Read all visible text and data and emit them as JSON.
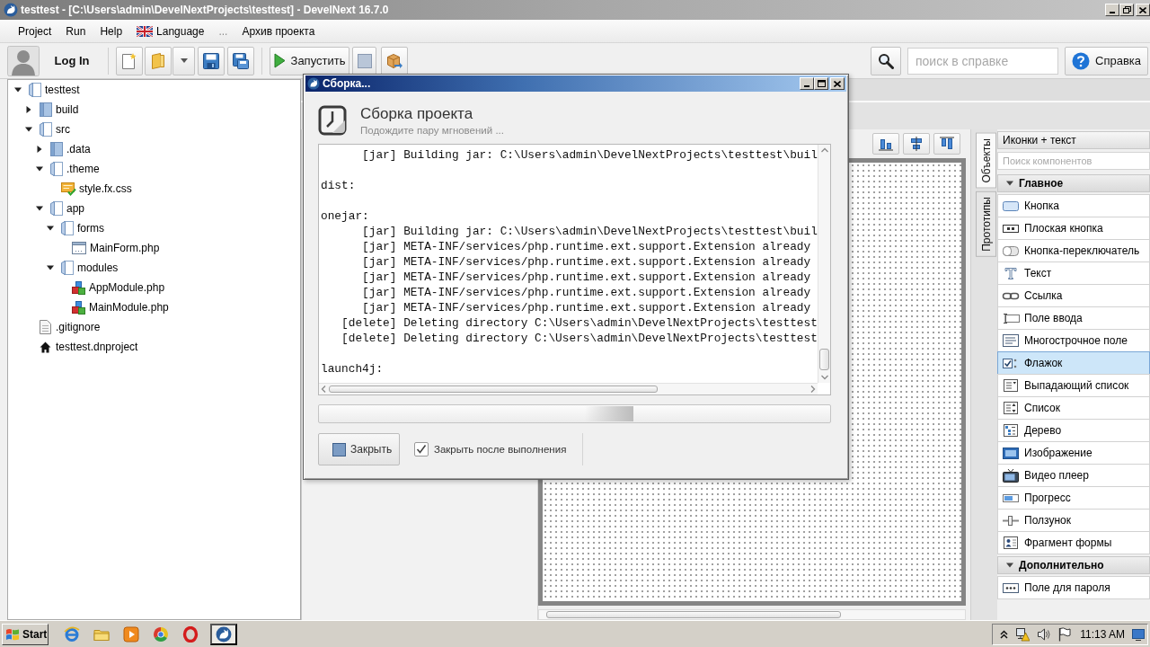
{
  "window": {
    "title": "testtest - [C:\\Users\\admin\\DevelNextProjects\\testtest] - DevelNext 16.7.0",
    "active": false
  },
  "menu": [
    {
      "label": "Project",
      "kind": "plain",
      "disabled": false
    },
    {
      "label": "Run",
      "kind": "plain",
      "disabled": false
    },
    {
      "label": "Help",
      "kind": "plain",
      "disabled": false
    },
    {
      "label": "Language",
      "kind": "flag",
      "disabled": false
    },
    {
      "label": "...",
      "kind": "plain",
      "disabled": true
    },
    {
      "label": "Архив проекта",
      "kind": "plain",
      "disabled": false
    }
  ],
  "toolbar": {
    "login": "Log In",
    "run": "Запустить",
    "help_search": {
      "placeholder": "поиск в справке"
    },
    "help": "Справка"
  },
  "project_tree": [
    {
      "label": "testtest",
      "kind": "folder",
      "expanded": true,
      "selected": false,
      "children": [
        {
          "label": "build",
          "kind": "folder",
          "expanded": false,
          "selected": false
        },
        {
          "label": "src",
          "kind": "folder",
          "expanded": true,
          "selected": false,
          "children": [
            {
              "label": ".data",
              "kind": "folder",
              "expanded": false,
              "selected": false
            },
            {
              "label": ".theme",
              "kind": "folder",
              "expanded": true,
              "selected": false,
              "children": [
                {
                  "label": "style.fx.css",
                  "kind": "stylesheet",
                  "selected": false
                }
              ]
            },
            {
              "label": "app",
              "kind": "folder",
              "expanded": true,
              "selected": false,
              "children": [
                {
                  "label": "forms",
                  "kind": "folder",
                  "expanded": true,
                  "selected": false,
                  "children": [
                    {
                      "label": "MainForm.php",
                      "kind": "form",
                      "selected": false
                    }
                  ]
                },
                {
                  "label": "modules",
                  "kind": "folder",
                  "expanded": true,
                  "selected": false,
                  "children": [
                    {
                      "label": "AppModule.php",
                      "kind": "module",
                      "selected": false
                    },
                    {
                      "label": "MainModule.php",
                      "kind": "module",
                      "selected": false
                    }
                  ]
                }
              ]
            }
          ]
        },
        {
          "label": ".gitignore",
          "kind": "file",
          "selected": false
        },
        {
          "label": "testtest.dnproject",
          "kind": "project",
          "selected": false
        }
      ]
    }
  ],
  "side_tabs": [
    {
      "label": "Объекты",
      "selected": true
    },
    {
      "label": "Прототипы",
      "selected": false
    }
  ],
  "components": {
    "view": "Иконки + текст",
    "search": {
      "placeholder": "Поиск компонентов"
    },
    "groups": [
      {
        "title": "Главное",
        "expanded": true,
        "items": [
          {
            "label": "Кнопка",
            "kind": "button",
            "selected": false
          },
          {
            "label": "Плоская кнопка",
            "kind": "flat_button",
            "selected": false
          },
          {
            "label": "Кнопка-переключатель",
            "kind": "toggle",
            "selected": false
          },
          {
            "label": "Текст",
            "kind": "label",
            "selected": false
          },
          {
            "label": "Ссылка",
            "kind": "link",
            "selected": false
          },
          {
            "label": "Поле ввода",
            "kind": "input",
            "selected": false
          },
          {
            "label": "Многострочное поле",
            "kind": "textarea",
            "selected": false
          },
          {
            "label": "Флажок",
            "kind": "checkbox",
            "selected": true
          },
          {
            "label": "Выпадающий список",
            "kind": "combobox",
            "selected": false
          },
          {
            "label": "Список",
            "kind": "list",
            "selected": false
          },
          {
            "label": "Дерево",
            "kind": "tree",
            "selected": false
          },
          {
            "label": "Изображение",
            "kind": "image",
            "selected": false
          },
          {
            "label": "Видео плеер",
            "kind": "video",
            "selected": false
          },
          {
            "label": "Прогресс",
            "kind": "progress",
            "selected": false
          },
          {
            "label": "Ползунок",
            "kind": "slider",
            "selected": false
          },
          {
            "label": "Фрагмент формы",
            "kind": "fragment",
            "selected": false
          }
        ]
      },
      {
        "title": "Дополнительно",
        "expanded": true,
        "items": [
          {
            "label": "Поле для пароля",
            "kind": "password",
            "selected": false
          }
        ]
      }
    ]
  },
  "build_dialog": {
    "title": "Сборка...",
    "active": true,
    "heading": "Сборка проекта",
    "subtitle": "Подождите пару мгновений ...",
    "log": [
      {
        "kind": "task",
        "text": "[jar] Building jar: C:\\Users\\admin\\DevelNextProjects\\testtest\\buil"
      },
      {
        "kind": "target",
        "text": "dist:"
      },
      {
        "kind": "target",
        "text": "onejar:"
      },
      {
        "kind": "task",
        "text": "[jar] Building jar: C:\\Users\\admin\\DevelNextProjects\\testtest\\buil"
      },
      {
        "kind": "task",
        "text": "[jar] META-INF/services/php.runtime.ext.support.Extension already"
      },
      {
        "kind": "task",
        "text": "[jar] META-INF/services/php.runtime.ext.support.Extension already"
      },
      {
        "kind": "task",
        "text": "[jar] META-INF/services/php.runtime.ext.support.Extension already"
      },
      {
        "kind": "task",
        "text": "[jar] META-INF/services/php.runtime.ext.support.Extension already"
      },
      {
        "kind": "task",
        "text": "[jar] META-INF/services/php.runtime.ext.support.Extension already"
      },
      {
        "kind": "task",
        "text": "[delete] Deleting directory C:\\Users\\admin\\DevelNextProjects\\testtest"
      },
      {
        "kind": "task",
        "text": "[delete] Deleting directory C:\\Users\\admin\\DevelNextProjects\\testtest"
      },
      {
        "kind": "target",
        "text": "launch4j:"
      }
    ],
    "progress": {
      "indeterminate": true
    },
    "close_button": "Закрыть",
    "close_after_finish": {
      "label": "Закрыть после выполнения",
      "checked": true
    }
  },
  "taskbar": {
    "start": "Start",
    "buttons": [
      {
        "kind": "ie",
        "selected": false
      },
      {
        "kind": "explorer",
        "selected": false
      },
      {
        "kind": "media",
        "selected": false
      },
      {
        "kind": "chrome",
        "selected": false
      },
      {
        "kind": "opera",
        "selected": false
      },
      {
        "kind": "develnext",
        "selected": true
      }
    ],
    "clock": "11:13 AM"
  }
}
